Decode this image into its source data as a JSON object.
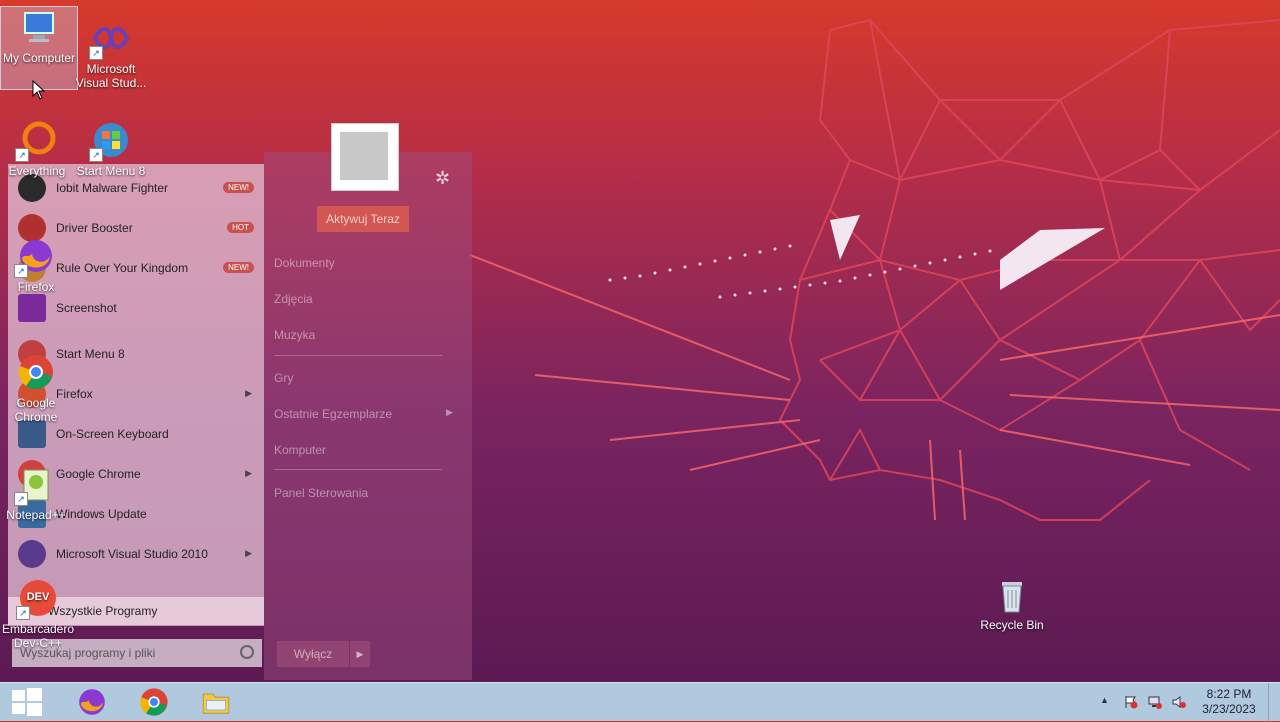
{
  "desktop": {
    "icons": [
      {
        "label": "My Computer",
        "icon": "computer-icon"
      },
      {
        "label": "Microsoft Visual Stud...",
        "icon": "visual-studio-icon"
      },
      {
        "label": "Everything",
        "icon": "everything-icon"
      },
      {
        "label": "Start Menu 8",
        "icon": "start-menu-8-icon"
      },
      {
        "label": "Firefox",
        "icon": "firefox-icon"
      },
      {
        "label": "Google Chrome",
        "icon": "chrome-icon"
      },
      {
        "label": "Notepad++",
        "icon": "notepad-plus-icon"
      },
      {
        "label": "Embarcadero Dev-C++",
        "icon": "devcpp-icon"
      },
      {
        "label": "Recycle Bin",
        "icon": "recycle-bin-icon"
      }
    ]
  },
  "start_menu": {
    "programs": [
      {
        "label": "Iobit Malware Fighter",
        "badge": "NEW!"
      },
      {
        "label": "Driver Booster",
        "badge": "HOT"
      },
      {
        "label": "Rule Over Your Kingdom",
        "badge": "NEW!"
      },
      {
        "label": "Screenshot"
      },
      {
        "label": "Start Menu 8"
      },
      {
        "label": "Firefox",
        "submenu": true
      },
      {
        "label": "On-Screen Keyboard"
      },
      {
        "label": "Google Chrome",
        "submenu": true
      },
      {
        "label": "Windows Update"
      },
      {
        "label": "Microsoft Visual Studio 2010",
        "submenu": true
      }
    ],
    "all_programs": "Wszystkie Programy",
    "search_placeholder": "Wyszukaj programy i pliki",
    "activate": "Aktywuj Teraz",
    "links": [
      "Dokumenty",
      "Zdjęcia",
      "Muzyka",
      "Gry",
      "Ostatnie Egzemplarze",
      "Komputer",
      "Panel Sterowania"
    ],
    "shutdown": "Wyłącz"
  },
  "taskbar": {
    "time": "8:22 PM",
    "date": "3/23/2023"
  },
  "colors": {
    "taskbar": "#b0c9df",
    "accent": "#d2382c"
  }
}
